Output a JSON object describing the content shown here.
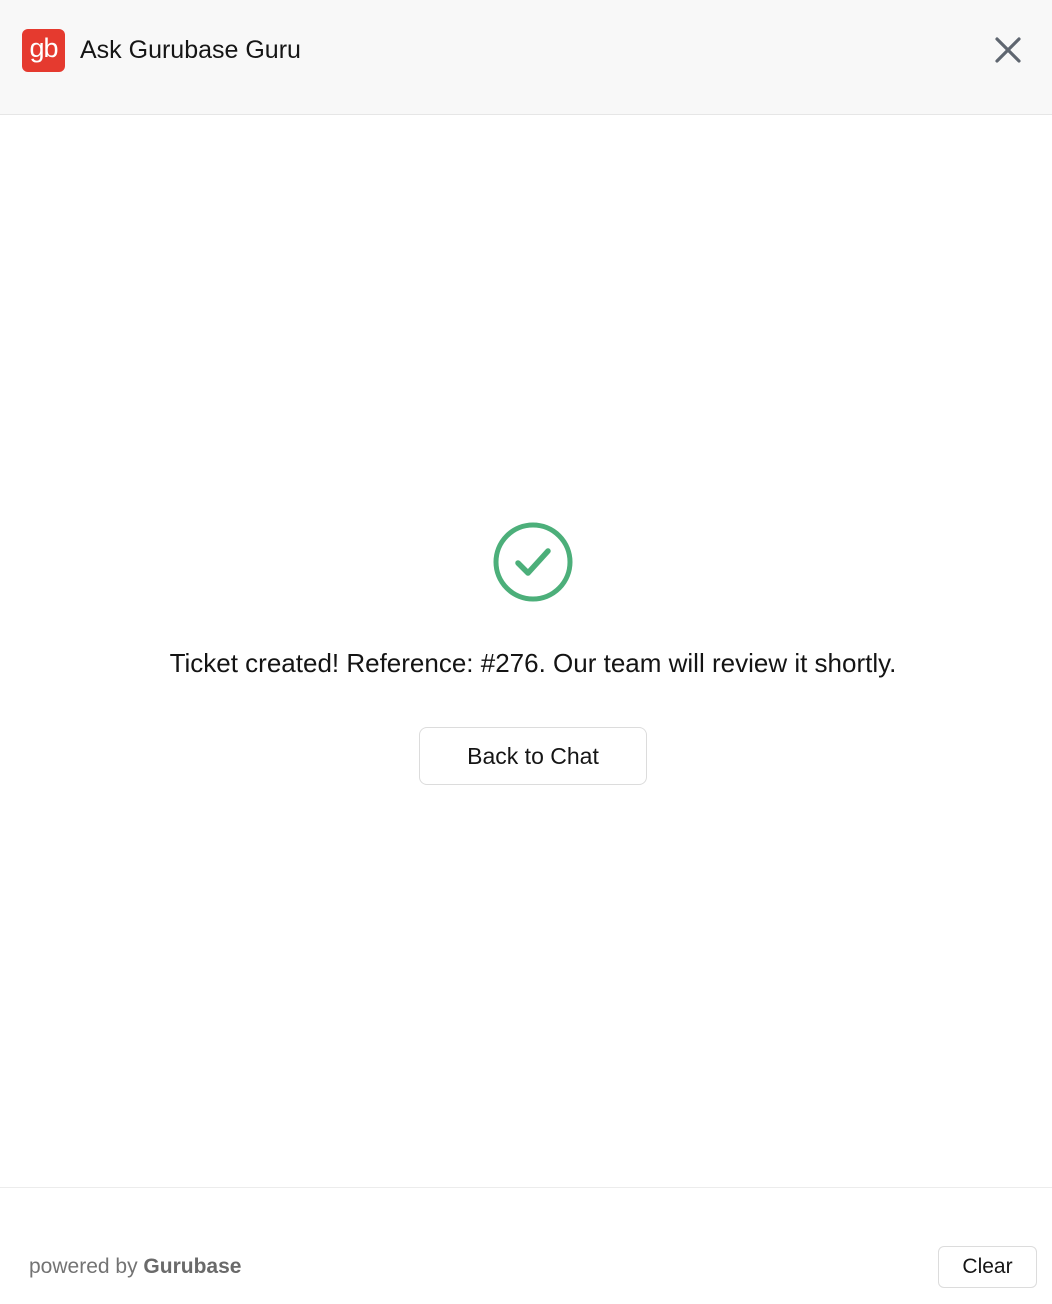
{
  "header": {
    "logo_text": "gb",
    "title": "Ask Gurubase Guru",
    "close_icon": "close-icon"
  },
  "status": {
    "icon": "check-circle-icon",
    "icon_color": "#4caf7a",
    "message": "Ticket created! Reference: #276. Our team will review it shortly.",
    "back_button_label": "Back to Chat"
  },
  "footer": {
    "powered_prefix": "powered by",
    "powered_brand": "Gurubase",
    "clear_label": "Clear"
  },
  "colors": {
    "brand": "#e53a2f",
    "success": "#4caf7a",
    "header_bg": "#f8f8f8"
  }
}
